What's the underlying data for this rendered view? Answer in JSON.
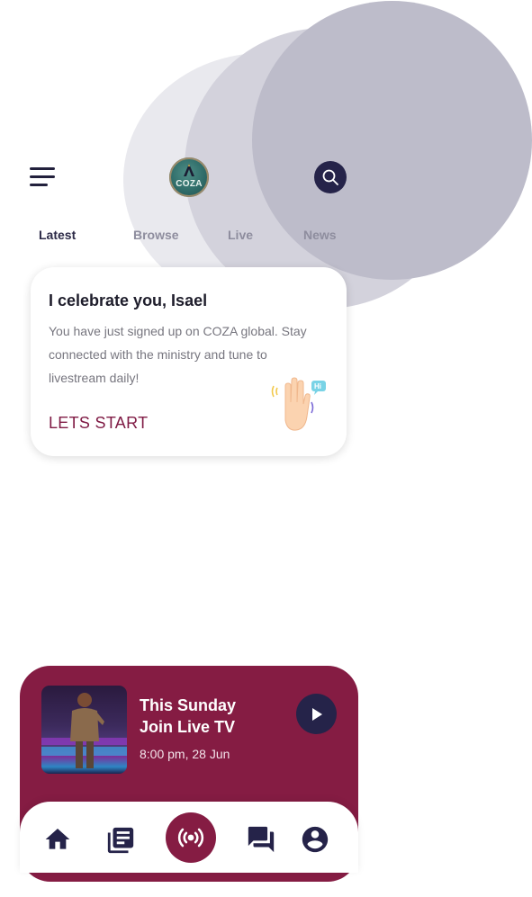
{
  "header": {
    "menu_icon": "hamburger-menu-icon",
    "logo_text": "COZA",
    "search_icon": "search-icon"
  },
  "tabs": [
    {
      "label": "Latest",
      "active": true
    },
    {
      "label": "Browse",
      "active": false
    },
    {
      "label": "Live",
      "active": false
    },
    {
      "label": "News",
      "active": false
    }
  ],
  "welcome_card": {
    "title": "I celebrate you, Isael",
    "body": "You have just signed up on COZA global. Stay connected with the ministry and tune to livestream daily!",
    "cta": "LETS START",
    "illustration_icon": "waving-hand-icon",
    "bubble_text": "Hi"
  },
  "live_card": {
    "title_line1": "This Sunday",
    "title_line2": "Join Live TV",
    "time": "8:00 pm, 28 Jun",
    "play_icon": "play-icon"
  },
  "bottom_nav": [
    {
      "name": "home",
      "icon": "home-icon"
    },
    {
      "name": "library",
      "icon": "library-icon"
    },
    {
      "name": "live",
      "icon": "live-broadcast-icon",
      "active": true
    },
    {
      "name": "chat",
      "icon": "chat-icon"
    },
    {
      "name": "profile",
      "icon": "account-circle-icon"
    }
  ],
  "colors": {
    "accent": "#851c43",
    "dark": "#252349",
    "tab_active": "#2c2a47",
    "tab_inactive": "#8e8d9e"
  }
}
